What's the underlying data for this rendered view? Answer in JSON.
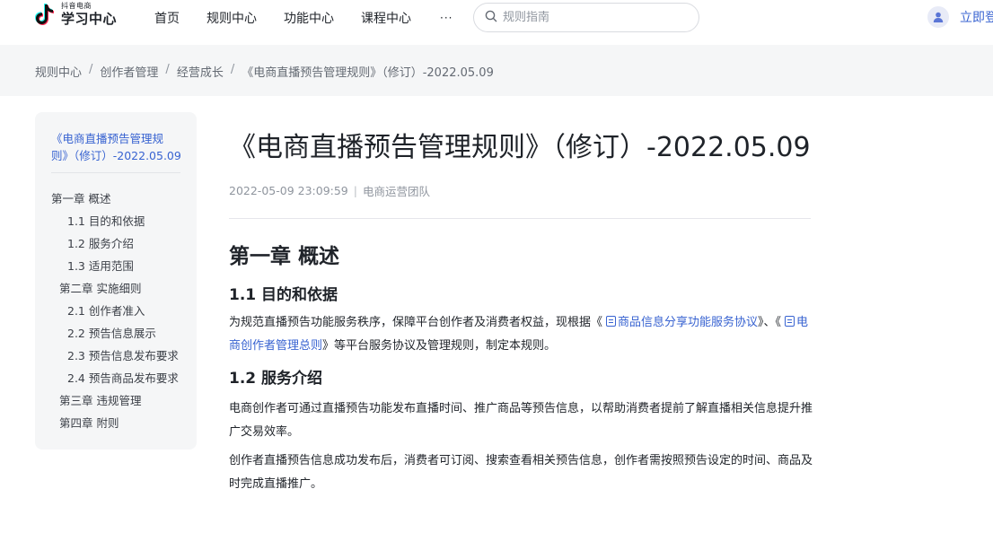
{
  "header": {
    "logo_small": "抖音电商",
    "logo_main": "学习中心",
    "nav": [
      "首页",
      "规则中心",
      "功能中心",
      "课程中心"
    ],
    "nav_more": "···",
    "search_placeholder": "规则指南",
    "login": "立即登"
  },
  "breadcrumb": {
    "items": [
      "规则中心",
      "创作者管理",
      "经营成长"
    ],
    "current": "《电商直播预告管理规则》（修订）-2022.05.09",
    "separator": "/"
  },
  "sidebar": {
    "title_line1": "《电商直播预告管理规",
    "title_line2": "则》（修订）-2022.05.09",
    "toc": [
      "第一章 概述",
      "1.1 目的和依据",
      "1.2 服务介绍",
      "1.3 适用范围",
      "第二章 实施细则",
      "2.1 创作者准入",
      "2.2 预告信息展示",
      "2.3 预告信息发布要求",
      "2.4 预告商品发布要求",
      "第三章 违规管理",
      "第四章 附则"
    ]
  },
  "article": {
    "title": "《电商直播预告管理规则》（修订）-2022.05.09",
    "datetime": "2022-05-09 23:09:59",
    "meta_sep": "|",
    "author": "电商运营团队",
    "h1": "第一章 概述",
    "s1": {
      "heading": "1.1 目的和依据",
      "p_before": "为规范直播预告功能服务秩序，保障平台创作者及消费者权益，现根据《",
      "link1": "商品信息分享功能服务协议",
      "p_mid": "》、《",
      "link2": "电商创作者管理总则",
      "p_after": "》等平台服务协议及管理规则，制定本规则。"
    },
    "s2": {
      "heading": "1.2 服务介绍",
      "p1": "电商创作者可通过直播预告功能发布直播时间、推广商品等预告信息，以帮助消费者提前了解直播相关信息提升推广交易效率。",
      "p2": "创作者直播预告信息成功发布后，消费者可订阅、搜索查看相关预告信息，创作者需按照预告设定的时间、商品及时完成直播推广。"
    }
  },
  "colors": {
    "link": "#3863d1",
    "breadcrumb_bg": "#f5f6f7",
    "text": "#1f2329",
    "muted": "#8f959e"
  },
  "icons": [
    "douyin-logo-icon",
    "search-icon",
    "user-avatar-icon",
    "document-icon"
  ]
}
